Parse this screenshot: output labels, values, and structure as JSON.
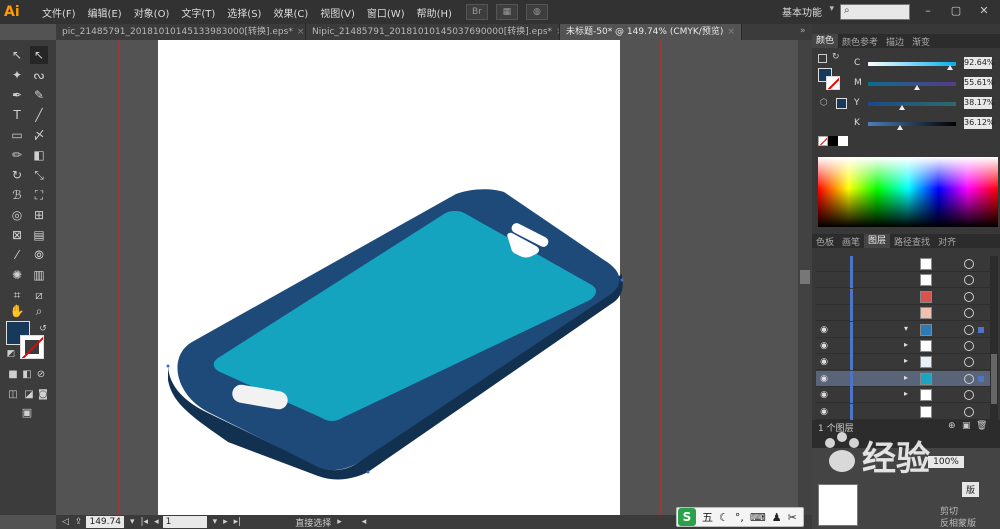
{
  "app": {
    "logo": "Ai",
    "menus": [
      "文件(F)",
      "编辑(E)",
      "对象(O)",
      "文字(T)",
      "选择(S)",
      "效果(C)",
      "视图(V)",
      "窗口(W)",
      "帮助(H)"
    ],
    "bridge_label": "Br",
    "workspace": "基本功能",
    "workspace_arrow": "▾",
    "search_icon": "search-icon"
  },
  "tabs": [
    {
      "label": "pic_21485791_20181010145133983000[转换].eps*",
      "close": "×"
    },
    {
      "label": "Nipic_21485791_20181010145037690000[转换].eps*",
      "close": "×"
    },
    {
      "label": "未标题-50* @ 149.74% (CMYK/预览)",
      "close": "×",
      "active": true
    }
  ],
  "status": {
    "zoom": "149.74",
    "page": "1",
    "tool_name": "直接选择"
  },
  "color_panel": {
    "tabs": [
      "颜色",
      "颜色参考",
      "描边",
      "渐变"
    ],
    "fill_color": "#183a5a",
    "channels": [
      {
        "label": "C",
        "value": "92.64",
        "percent": 92.64,
        "gradient": "linear-gradient(to right,#fff,#00aeef)"
      },
      {
        "label": "M",
        "value": "55.61",
        "percent": 55.61,
        "gradient": "linear-gradient(to right,#0b6c8c,#5a3a8a)"
      },
      {
        "label": "Y",
        "value": "38.17",
        "percent": 38.17,
        "gradient": "linear-gradient(to right,#1b4a8a,#2e6a6a)"
      },
      {
        "label": "K",
        "value": "36.12",
        "percent": 36.12,
        "gradient": "linear-gradient(to right,#4a7fb8,#000)"
      }
    ],
    "percent_sign": "%"
  },
  "layers_panel": {
    "tabs": [
      "色板",
      "画笔",
      "图层",
      "路径查找",
      "对齐"
    ],
    "footer": "1 个图层",
    "rows": [
      {
        "eye": false,
        "tri": "",
        "thumb": "#ffffff"
      },
      {
        "eye": false,
        "tri": "",
        "thumb": "#ffffff"
      },
      {
        "eye": false,
        "tri": "",
        "thumb": "#d9534f"
      },
      {
        "eye": false,
        "tri": "",
        "thumb": "#f2c0b0"
      },
      {
        "eye": true,
        "tri": "▾",
        "thumb": "#2a7bb8",
        "sel": false
      },
      {
        "eye": true,
        "tri": "▸",
        "thumb": "#ffffff"
      },
      {
        "eye": true,
        "tri": "▸",
        "thumb": "#e8f0f8"
      },
      {
        "eye": true,
        "tri": "▸",
        "thumb": "#1aa5c0",
        "sel": true
      },
      {
        "eye": true,
        "tri": "▸",
        "thumb": "#ffffff"
      },
      {
        "eye": true,
        "tri": "",
        "thumb": "#ffffff"
      }
    ]
  },
  "navigator": {
    "zoom": "100%",
    "btn_label": "版",
    "opt1": "剪切",
    "opt2": "反相蒙版"
  },
  "watermark": {
    "text": "经验"
  },
  "ime": {
    "logo": "S",
    "mode": "五"
  }
}
